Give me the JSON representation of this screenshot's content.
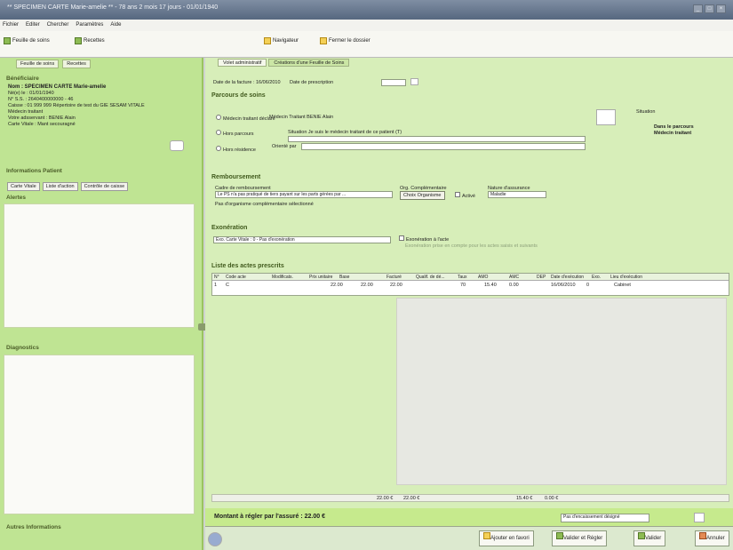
{
  "window": {
    "title": "** SPECIMEN CARTE Marie-amelie ** - 78 ans 2 mois 17 jours - 01/01/1940"
  },
  "menu": [
    "Fichier",
    "Editer",
    "Chercher",
    "Paramètres",
    "Aide"
  ],
  "toolbar": {
    "feuille": "Feuille de soins",
    "recettes": "Recettes",
    "navigateur": "Navigateur",
    "fermer": "Fermer le dossier"
  },
  "left": {
    "tabs": [
      "Feuille de soins",
      "Recettes"
    ],
    "beneficiaire": "Bénéficiaire",
    "nom": "Nom : SPECIMEN CARTE Marie-amelie",
    "naissance": "Né(e) le : 01/01/1940",
    "ss": "N° S.S. : 2640400000000 - 46",
    "caisse": "Caisse : 01 999 999 Répertoire de test du GIE SESAM VITALE",
    "medecin": "Médecin traitant",
    "votre": "Votre adsservant : BENIE Alain",
    "carte": "Carte Vitale : Mant secouragné",
    "infos": "Informations Patient",
    "subtabs": [
      "Carte Vitale",
      "Liste d'action",
      "Contrôle de caisse"
    ],
    "alertes": "Alertes",
    "diagnostics": "Diagnostics",
    "autres": "Autres Informations"
  },
  "right": {
    "tabs": [
      "Volet administratif",
      "Créations d'une Feuille de Soins"
    ],
    "date_facture": "Date de la facture : 16/06/2010",
    "date_prescription": "Date de prescription",
    "parcours": "Parcours de soins",
    "radio1": "Médecin traitant déclaré",
    "radio1_label": "Médecin Traitant BENIE Alain",
    "radio2": "Hors parcours",
    "radio2_situation": "Situation Je suis le médecin traitant de ce patient (T)",
    "radio3": "Hors résidence",
    "adresse": "Orienté par",
    "situation": "Situation",
    "situation_status": "Dans le parcours",
    "situation_status2": "Médecin traitant",
    "remb": "Remboursement",
    "cadre": "Cadre de remboursement",
    "cadre_value": "Le PS n'a pas pratiqué de tiers payant sur les parts gérées par ...",
    "org": "Org. Complémentaire",
    "org_btn": "Choix Organisme",
    "activer": "Activé",
    "nature": "Nature d'assurance",
    "nature_value": "Maladie",
    "pas_org": "Pas d'organisme complémentaire sélectionné",
    "exon": "Exonération",
    "exon_value": "Exo. Carte Vitale : 0 - Pas d'exonération",
    "exon_check": "Exonération à l'acte",
    "exon_note": "Exonération prise en compte pour les actes saisis et suivants",
    "liste": "Liste des actes prescrits",
    "columns": [
      "N°",
      "Code acte",
      "Modificats.",
      "Prix unitaire",
      "Base",
      "Facturé",
      "Qualif. de dé...",
      "Taux",
      "AMO",
      "AMC",
      "DEP",
      "Date d'exécution",
      "Exo.",
      "Lieu d'exécution"
    ],
    "row": [
      "1",
      "C",
      "",
      "22.00",
      "22.00",
      "22.00",
      "",
      "70",
      "15.40",
      "0.00",
      "",
      "16/06/2010",
      "0",
      "Cabinet"
    ],
    "sum_base": "22.00 €",
    "sum_fact": "22.00 €",
    "sum_amo": "15.40 €",
    "sum_amc": "0.00 €",
    "montant": "Montant à régler par l'assuré : 22.00 €",
    "pas_encaissement": "Pas d'encaissement désigné"
  },
  "bottom": {
    "ajouter": "Ajouter en favori",
    "valider_reg": "Valider et Régler",
    "valider": "Valider",
    "annuler": "Annuler"
  }
}
